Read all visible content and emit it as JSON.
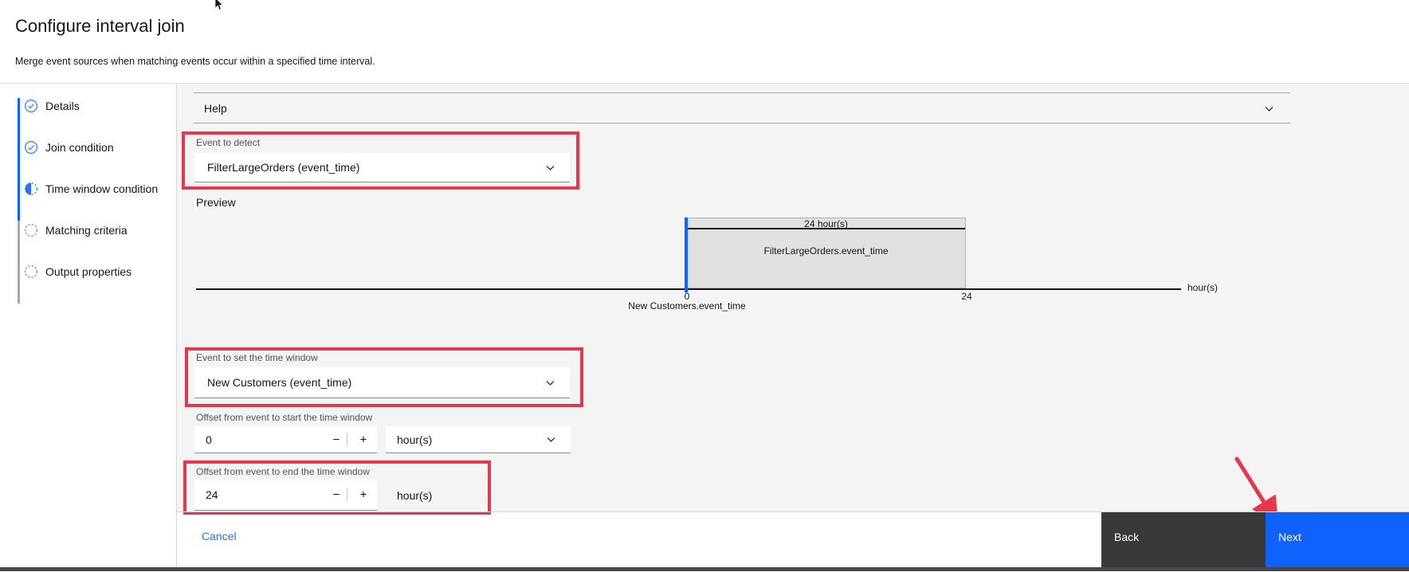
{
  "header": {
    "title": "Configure interval join",
    "subtitle": "Merge event sources when matching events occur within a specified time interval."
  },
  "steps": [
    {
      "label": "Details",
      "state": "complete"
    },
    {
      "label": "Join condition",
      "state": "complete"
    },
    {
      "label": "Time window condition",
      "state": "current"
    },
    {
      "label": "Matching criteria",
      "state": "incomplete"
    },
    {
      "label": "Output properties",
      "state": "incomplete"
    }
  ],
  "help": {
    "label": "Help"
  },
  "form": {
    "event_to_detect": {
      "label": "Event to detect",
      "value": "FilterLargeOrders (event_time)"
    },
    "preview": {
      "label": "Preview",
      "window_duration_label": "24 hour(s)",
      "window_event_label": "FilterLargeOrders.event_time",
      "axis_start_tick": "0",
      "axis_end_tick": "24",
      "axis_unit_label": "hour(s)",
      "axis_event_label": "New Customers.event_time"
    },
    "event_to_set_window": {
      "label": "Event to set the time window",
      "value": "New Customers (event_time)"
    },
    "offset_start": {
      "label": "Offset from event to start the time window",
      "value": "0",
      "unit": "hour(s)",
      "decrement": "−",
      "increment": "+"
    },
    "offset_end": {
      "label": "Offset from event to end the time window",
      "value": "24",
      "unit": "hour(s)",
      "decrement": "−",
      "increment": "+"
    }
  },
  "footer": {
    "cancel_label": "Cancel",
    "back_label": "Back",
    "next_label": "Next"
  },
  "colors": {
    "accent_blue": "#0f62fe",
    "icon_blue": "#4589ff",
    "annotation_red": "#e5384a",
    "button_dark_bg": "#393939",
    "panel_bg": "#f4f4f4"
  }
}
